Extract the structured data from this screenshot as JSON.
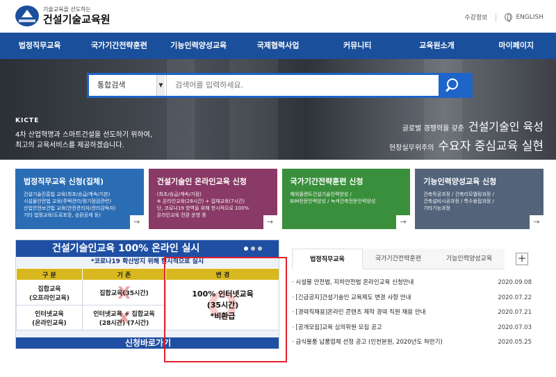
{
  "header": {
    "logo_badge": "KICTE",
    "tagline": "기술교육을 선도하는",
    "org_name": "건설기술교육원",
    "util_links": [
      "수강정보",
      "ENGLISH"
    ]
  },
  "nav": {
    "items": [
      "법정직무교육",
      "국가기간전략훈련",
      "기능인력양성교육",
      "국제협력사업",
      "커뮤니티",
      "교육원소개",
      "마이페이지"
    ]
  },
  "search": {
    "scope": "통합검색",
    "placeholder": "검색어를 입력하세요."
  },
  "hero": {
    "badge": "KICTE",
    "left_line1": "4차 산업혁명과 스마트건설을 선도하기 위하여,",
    "left_line2": "최고의 교육서비스를 제공하겠습니다.",
    "right_line1_small": "글로벌 경쟁력을 갖춘",
    "right_line1_big": "건설기술인 육성",
    "right_line2_small": "현장실무위주의",
    "right_line2_big": "수요자 중심교육 실현"
  },
  "cards": [
    {
      "title": "법정직무교육 신청(집체)",
      "lines": [
        "건설기술진흥법 교육(최초/승급/계속/기본)",
        "시설물안전법 교육(주택관리/정기점검관련)",
        "산업안전보건법 교육(안전관리자/관리감독자)",
        "기타 법정교육(도로포장, 승환공제 등)"
      ]
    },
    {
      "title": "건설기술인 온라인교육 신청",
      "lines": [
        "(최초/승급/계속/가점)",
        "※ 온라인교육(28시간) + 집체교육(7시간)",
        "단, 코로나19 방역을 위해 한시적으로 100%",
        "온라인교육 전환 운영 중"
      ]
    },
    {
      "title": "국가기간전략훈련 신청",
      "lines": [
        "해외플랜트건설기술인력양성 /",
        "BIM전문인력양성 / 녹색건축전문인력양성"
      ]
    },
    {
      "title": "기능인력양성교육 신청",
      "lines": [
        "건축목공과정 / 건축리모델링과정 /",
        "건축설비시공과정 / 특수용접과정 /",
        "기타기능과정"
      ]
    }
  ],
  "banner": {
    "title": "건설기술인교육 100% 온라인 실시",
    "subtitle": "*코로나19 확산방지 위해 한시적으로 실시",
    "headers": [
      "구 분",
      "기 존",
      "변 경"
    ],
    "row1_label": [
      "집합교육",
      "(오프라인교육)"
    ],
    "row1_old": "집합교육(35시간)",
    "row2_label": [
      "인터넷교육",
      "(온라인교육)"
    ],
    "row2_old": [
      "인터넷교육 + 집합교육",
      "(28시간)  (7시간)"
    ],
    "change_lines": [
      "100% 인터넷교육",
      "(35시간)",
      "*비환급"
    ],
    "apply_label": "신청바로가기"
  },
  "news": {
    "tabs": [
      "법정직무교육",
      "국가기간전략훈련",
      "기능인력양성교육"
    ],
    "items": [
      {
        "title": "· 시설물 안전법, 지하안전법 온라인교육 신청안내",
        "date": "2020.09.08"
      },
      {
        "title": "· [긴급공지]건설기술인 교육제도 변경 사항 안내",
        "date": "2020.07.22"
      },
      {
        "title": "· [경력직채용]온라인 콘텐츠 제작 경력 직원 채용 안내",
        "date": "2020.07.21"
      },
      {
        "title": "· [공개모집]교육 심의위원 모집 공고",
        "date": "2020.07.03"
      },
      {
        "title": "· 급식물품 납품업체 선정 공고 (인천본원, 2020년도 하반기)",
        "date": "2020.05.25"
      }
    ]
  },
  "colors": {
    "primary": "#1a4f9b",
    "search": "#1f64c8",
    "highlight": "#e01f2c"
  }
}
